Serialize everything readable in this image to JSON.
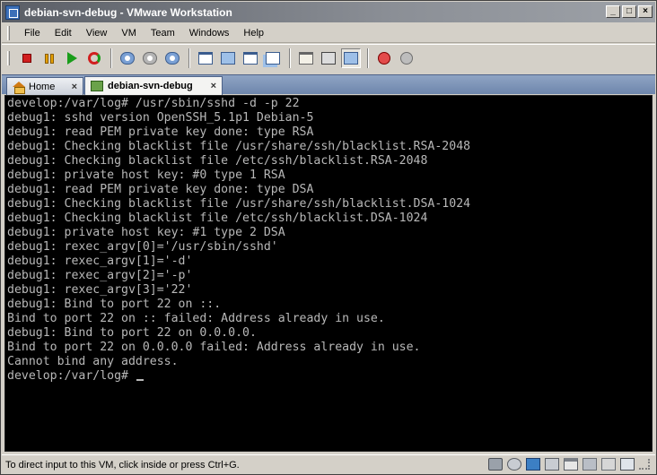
{
  "window": {
    "title": "debian-svn-debug - VMware Workstation",
    "controls": {
      "minimize": "_",
      "maximize": "□",
      "close": "×"
    }
  },
  "menubar": {
    "items": [
      "File",
      "Edit",
      "View",
      "VM",
      "Team",
      "Windows",
      "Help"
    ]
  },
  "toolbar": {
    "icons": [
      "power-off-icon",
      "suspend-icon",
      "power-on-icon",
      "reset-icon",
      "take-snapshot-icon",
      "revert-snapshot-icon",
      "snapshot-manager-icon",
      "quick-switch-icon",
      "full-screen-icon",
      "unity-icon",
      "multi-monitor-icon",
      "show-folder-icon",
      "show-console-icon",
      "record-icon",
      "replay-icon"
    ],
    "pressed_icon": "show-console-icon"
  },
  "tabs": {
    "home_label": "Home",
    "active_label": "debian-svn-debug",
    "close_glyph": "×"
  },
  "console": {
    "lines": [
      "develop:/var/log# /usr/sbin/sshd -d -p 22",
      "debug1: sshd version OpenSSH_5.1p1 Debian-5",
      "debug1: read PEM private key done: type RSA",
      "debug1: Checking blacklist file /usr/share/ssh/blacklist.RSA-2048",
      "debug1: Checking blacklist file /etc/ssh/blacklist.RSA-2048",
      "debug1: private host key: #0 type 1 RSA",
      "debug1: read PEM private key done: type DSA",
      "debug1: Checking blacklist file /usr/share/ssh/blacklist.DSA-1024",
      "debug1: Checking blacklist file /etc/ssh/blacklist.DSA-1024",
      "debug1: private host key: #1 type 2 DSA",
      "debug1: rexec_argv[0]='/usr/sbin/sshd'",
      "debug1: rexec_argv[1]='-d'",
      "debug1: rexec_argv[2]='-p'",
      "debug1: rexec_argv[3]='22'",
      "debug1: Bind to port 22 on ::.",
      "Bind to port 22 on :: failed: Address already in use.",
      "debug1: Bind to port 22 on 0.0.0.0.",
      "Bind to port 22 on 0.0.0.0 failed: Address already in use.",
      "Cannot bind any address."
    ],
    "prompt": "develop:/var/log# "
  },
  "statusbar": {
    "text": "To direct input to this VM, click inside or press Ctrl+G.",
    "icons": [
      "hard-disk-icon",
      "cd-rom-icon",
      "network-icon",
      "floppy-icon",
      "printer-icon",
      "usb-icon",
      "sound-icon",
      "message-log-icon"
    ]
  },
  "colors": {
    "console_bg": "#000000",
    "console_fg": "#b8b8b8",
    "tabstrip": "#6e86ac"
  }
}
